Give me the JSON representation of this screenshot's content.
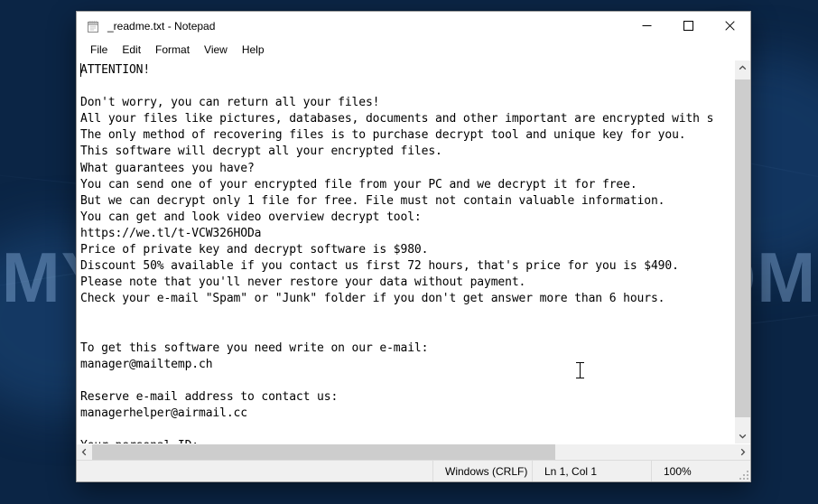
{
  "desktop": {
    "watermark": "MYANTISPYWARE.COM",
    "watermark_color": "#96bee b"
  },
  "window": {
    "title": "_readme.txt - Notepad",
    "icon": "notepad-icon",
    "controls": {
      "minimize": "—",
      "maximize": "☐",
      "close": "✕"
    }
  },
  "menubar": {
    "items": [
      {
        "label": "File"
      },
      {
        "label": "Edit"
      },
      {
        "label": "Format"
      },
      {
        "label": "View"
      },
      {
        "label": "Help"
      }
    ]
  },
  "document": {
    "filename": "_readme.txt",
    "lines": [
      "ATTENTION!",
      "",
      "Don't worry, you can return all your files!",
      "All your files like pictures, databases, documents and other important are encrypted with s",
      "The only method of recovering files is to purchase decrypt tool and unique key for you.",
      "This software will decrypt all your encrypted files.",
      "What guarantees you have?",
      "You can send one of your encrypted file from your PC and we decrypt it for free.",
      "But we can decrypt only 1 file for free. File must not contain valuable information.",
      "You can get and look video overview decrypt tool:",
      "https://we.tl/t-VCW326HODa",
      "Price of private key and decrypt software is $980.",
      "Discount 50% available if you contact us first 72 hours, that's price for you is $490.",
      "Please note that you'll never restore your data without payment.",
      "Check your e-mail \"Spam\" or \"Junk\" folder if you don't get answer more than 6 hours.",
      "",
      "",
      "To get this software you need write on our e-mail:",
      "manager@mailtemp.ch",
      "",
      "Reserve e-mail address to contact us:",
      "managerhelper@airmail.cc",
      "",
      "Your personal ID:"
    ],
    "ransom_price_full": "$980",
    "ransom_price_discount": "$490",
    "discount_percent": "50%",
    "discount_window_hours": "72",
    "response_window_hours": "6",
    "video_url": "https://we.tl/t-VCW326HODa",
    "contact_email": "manager@mailtemp.ch",
    "reserve_email": "managerhelper@airmail.cc"
  },
  "scrollbars": {
    "vertical": {
      "up_arrow": "˄",
      "down_arrow": "˅"
    },
    "horizontal": {
      "left_arrow": "‹",
      "right_arrow": "›"
    }
  },
  "statusbar": {
    "line_ending": "Windows (CRLF)",
    "cursor_position": "Ln 1, Col 1",
    "zoom": "100%"
  }
}
